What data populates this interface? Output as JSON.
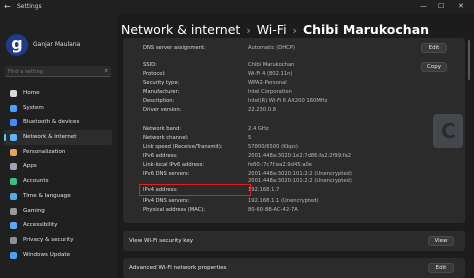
{
  "window": {
    "title": "Settings",
    "back_icon": "arrow-left-icon"
  },
  "user": {
    "name": "Ganjar Maulana",
    "avatar_letter": "g"
  },
  "search": {
    "placeholder": "Find a setting"
  },
  "sidebar": {
    "items": [
      {
        "label": "Home",
        "icon": "home-icon",
        "color": "#d9d9d9"
      },
      {
        "label": "System",
        "icon": "system-icon",
        "color": "#4aa0ff"
      },
      {
        "label": "Bluetooth & devices",
        "icon": "bluetooth-icon",
        "color": "#3c8cff"
      },
      {
        "label": "Network & internet",
        "icon": "network-icon",
        "color": "#5fb6ff",
        "active": true
      },
      {
        "label": "Personalization",
        "icon": "brush-icon",
        "color": "#e8a35a"
      },
      {
        "label": "Apps",
        "icon": "apps-icon",
        "color": "#9aa4b2"
      },
      {
        "label": "Accounts",
        "icon": "person-icon",
        "color": "#3fbf7f"
      },
      {
        "label": "Time & language",
        "icon": "globe-icon",
        "color": "#4ab0e8"
      },
      {
        "label": "Gaming",
        "icon": "gamepad-icon",
        "color": "#9a9a9a"
      },
      {
        "label": "Accessibility",
        "icon": "accessibility-icon",
        "color": "#5aa8ff"
      },
      {
        "label": "Privacy & security",
        "icon": "shield-icon",
        "color": "#8a8f99"
      },
      {
        "label": "Windows Update",
        "icon": "update-icon",
        "color": "#4aa0ff"
      }
    ]
  },
  "breadcrumb": {
    "part1": "Network & internet",
    "part2": "Wi-Fi",
    "part3": "Chibi Marukochan"
  },
  "details": {
    "dns_assignment_label": "DNS server assignment:",
    "dns_assignment_value": "Automatic (DHCP)",
    "edit_label": "Edit",
    "copy_label": "Copy",
    "view_label": "View",
    "rows_block1": [
      {
        "label": "SSID:",
        "value": "Chibi Marukochan"
      },
      {
        "label": "Protocol:",
        "value": "Wi-Fi 4 (802.11n)"
      },
      {
        "label": "Security type:",
        "value": "WPA2-Personal"
      },
      {
        "label": "Manufacturer:",
        "value": "Intel Corporation"
      },
      {
        "label": "Description:",
        "value": "Intel(R) Wi-Fi 6 AX200 160MHz"
      },
      {
        "label": "Driver version:",
        "value": "22.230.0.8"
      }
    ],
    "rows_block2": [
      {
        "label": "Network band:",
        "value": "2.4 GHz"
      },
      {
        "label": "Network channel:",
        "value": "5"
      },
      {
        "label": "Link speed (Receive/Transmit):",
        "value": "57800/6500 (Kbps)"
      },
      {
        "label": "IPv6 address:",
        "value": "2001:448a:3020:1e2:7d86:fa2:2f99:fa2"
      },
      {
        "label": "Link-local IPv6 address:",
        "value": "fe80::7c7f:ea2:9d45:a0e"
      },
      {
        "label": "IPv6 DNS servers:",
        "value": "2001:448a:3020:101:2:2 (Unencrypted)"
      },
      {
        "label": "",
        "value": "2001:448a:3020:101:2:2 (Unencrypted)"
      },
      {
        "label": "IPv4 address:",
        "value": "192.168.1.7"
      },
      {
        "label": "IPv4 DNS servers:",
        "value": "192.168.1.1 (Unencrypted)"
      },
      {
        "label": "Physical address (MAC):",
        "value": "80-60-8B-AC-42-7A"
      }
    ]
  },
  "security_key": {
    "label": "View Wi-Fi security key"
  },
  "advanced": {
    "label": "Advanced Wi-Fi network properties"
  },
  "colors": {
    "accent": "#60cdff",
    "highlight": "#e02020"
  }
}
